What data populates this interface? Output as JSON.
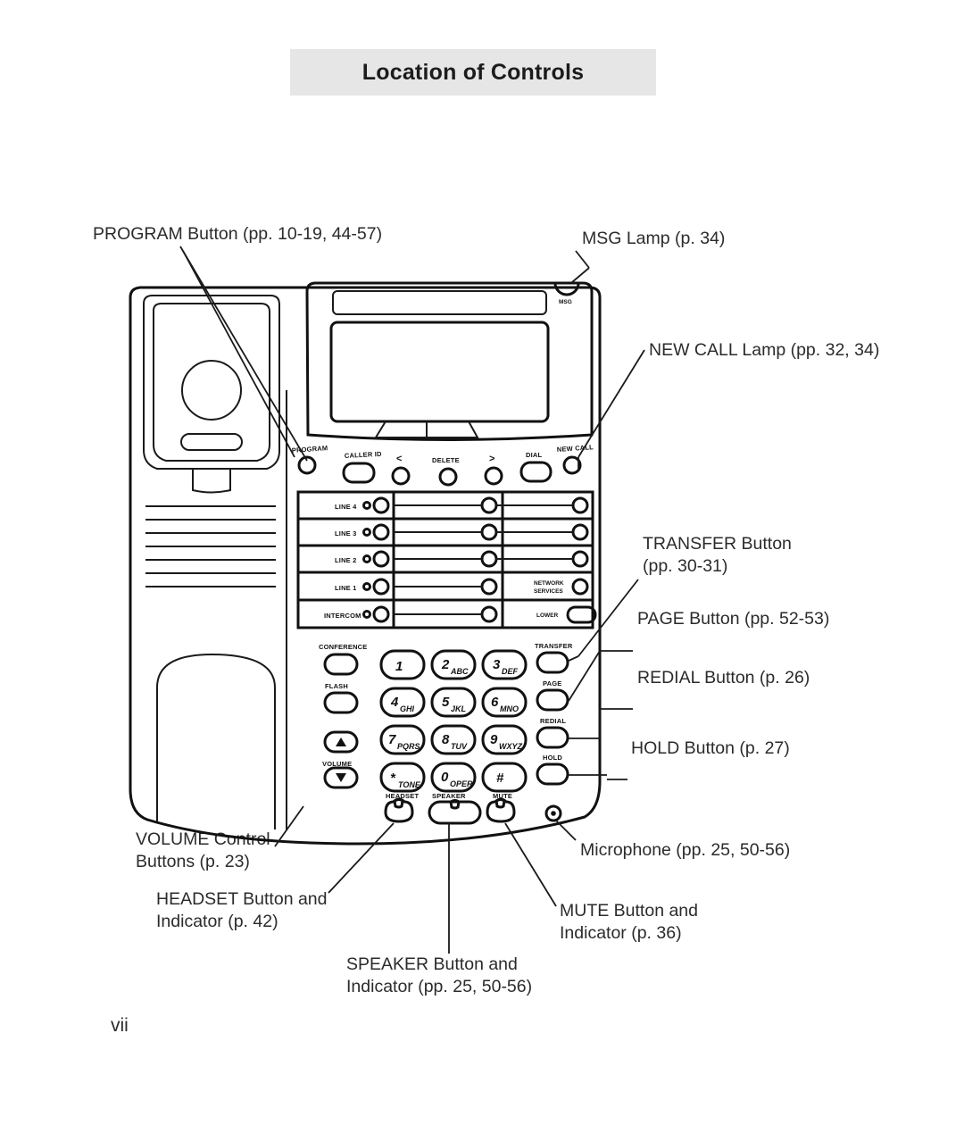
{
  "page": {
    "title": "Location of Controls",
    "page_number": "vii"
  },
  "callouts": [
    {
      "id": "program",
      "text": "PROGRAM Button (pp. 10-19, 44-57)"
    },
    {
      "id": "msg-lamp",
      "text": "MSG Lamp (p. 34)"
    },
    {
      "id": "new-call",
      "text": "NEW CALL Lamp (pp. 32, 34)"
    },
    {
      "id": "transfer",
      "text": "TRANSFER Button\n(pp. 30-31)"
    },
    {
      "id": "page-btn",
      "text": "PAGE Button (pp. 52-53)"
    },
    {
      "id": "redial",
      "text": "REDIAL Button (p. 26)"
    },
    {
      "id": "hold",
      "text": "HOLD Button (p. 27)"
    },
    {
      "id": "microphone",
      "text": "Microphone (pp. 25, 50-56)"
    },
    {
      "id": "mute",
      "text": "MUTE Button and\nIndicator (p. 36)"
    },
    {
      "id": "volume",
      "text": "VOLUME Control\nButtons (p. 23)"
    },
    {
      "id": "headset",
      "text": "HEADSET Button and\nIndicator (p. 42)"
    },
    {
      "id": "speaker",
      "text": "SPEAKER Button and\nIndicator (pp. 25, 50-56)"
    }
  ],
  "device": {
    "msg_lamp_label": "MSG",
    "soft_row": [
      {
        "label": "PROGRAM"
      },
      {
        "label": "CALLER ID"
      },
      {
        "label": "<"
      },
      {
        "label": "DELETE"
      },
      {
        "label": ">"
      },
      {
        "label": "DIAL"
      },
      {
        "label": "NEW CALL"
      }
    ],
    "line_keys": [
      {
        "label": "LINE 4"
      },
      {
        "label": "LINE 3"
      },
      {
        "label": "LINE 2"
      },
      {
        "label": "LINE 1"
      },
      {
        "label": "INTERCOM"
      }
    ],
    "right_line_keys": [
      {
        "label": ""
      },
      {
        "label": ""
      },
      {
        "label": ""
      },
      {
        "label": "NETWORK\nSERVICES"
      },
      {
        "label": "LOWER"
      }
    ],
    "right_line_key_line1": "NETWORK",
    "right_line_key_line2": "SERVICES",
    "right_line_key_lower": "LOWER",
    "left_function_keys": [
      {
        "label": "CONFERENCE"
      },
      {
        "label": "FLASH"
      },
      {
        "label": "VOLUME"
      }
    ],
    "right_function_keys": [
      {
        "label": "TRANSFER"
      },
      {
        "label": "PAGE"
      },
      {
        "label": "REDIAL"
      },
      {
        "label": "HOLD"
      }
    ],
    "keypad": [
      {
        "digit": "1",
        "letters": ""
      },
      {
        "digit": "2",
        "letters": "ABC"
      },
      {
        "digit": "3",
        "letters": "DEF"
      },
      {
        "digit": "4",
        "letters": "GHI"
      },
      {
        "digit": "5",
        "letters": "JKL"
      },
      {
        "digit": "6",
        "letters": "MNO"
      },
      {
        "digit": "7",
        "letters": "PQRS"
      },
      {
        "digit": "8",
        "letters": "TUV"
      },
      {
        "digit": "9",
        "letters": "WXYZ"
      },
      {
        "digit": "*",
        "letters": "TONE"
      },
      {
        "digit": "0",
        "letters": "OPER"
      },
      {
        "digit": "#",
        "letters": ""
      }
    ],
    "bottom_keys": [
      {
        "label": "HEADSET"
      },
      {
        "label": "SPEAKER"
      },
      {
        "label": "MUTE"
      }
    ],
    "volume_up_glyph": "▲",
    "volume_down_glyph": "▼"
  },
  "colors": {
    "banner_bg": "#e6e6e6",
    "ink": "#1a1a1a",
    "text": "#2b2b2b"
  }
}
